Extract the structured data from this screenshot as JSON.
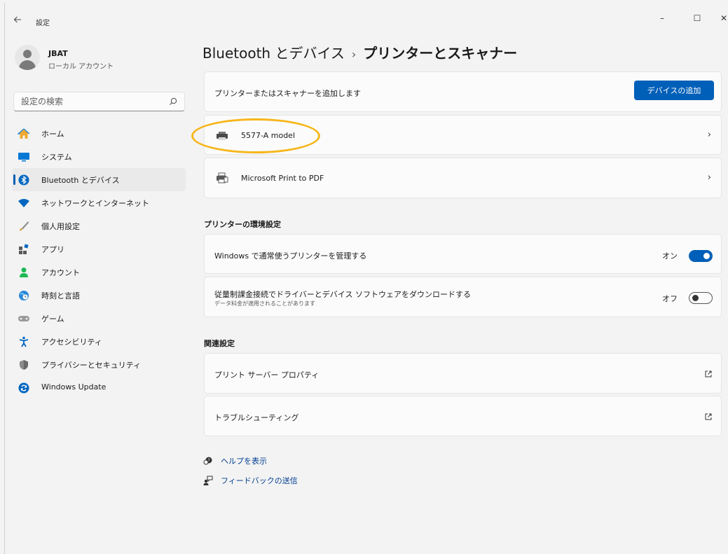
{
  "window": {
    "back_icon": "arrow-left-icon",
    "title": "設定",
    "minimize": "–",
    "maximize": "☐",
    "close": "✕"
  },
  "profile": {
    "name": "JBAT",
    "account_type": "ローカル アカウント"
  },
  "search": {
    "placeholder": "設定の検索"
  },
  "sidebar": {
    "items": [
      {
        "label": "ホーム",
        "icon": "home-icon"
      },
      {
        "label": "システム",
        "icon": "system-icon"
      },
      {
        "label": "Bluetooth とデバイス",
        "icon": "bluetooth-icon",
        "active": true
      },
      {
        "label": "ネットワークとインターネット",
        "icon": "wifi-icon"
      },
      {
        "label": "個人用設定",
        "icon": "brush-icon"
      },
      {
        "label": "アプリ",
        "icon": "apps-icon"
      },
      {
        "label": "アカウント",
        "icon": "person-icon"
      },
      {
        "label": "時刻と言語",
        "icon": "globe-clock-icon"
      },
      {
        "label": "ゲーム",
        "icon": "controller-icon"
      },
      {
        "label": "アクセシビリティ",
        "icon": "accessibility-icon"
      },
      {
        "label": "プライバシーとセキュリティ",
        "icon": "shield-icon"
      },
      {
        "label": "Windows Update",
        "icon": "update-icon"
      }
    ]
  },
  "breadcrumb": {
    "parent": "Bluetooth とデバイス",
    "separator": "›",
    "current": "プリンターとスキャナー"
  },
  "add_card": {
    "label": "プリンターまたはスキャナーを追加します",
    "button": "デバイスの追加"
  },
  "devices": [
    {
      "name": "5577-A model",
      "chevron": "›"
    },
    {
      "name": "Microsoft Print to PDF",
      "chevron": "›"
    }
  ],
  "printer_settings": {
    "title": "プリンターの環境設定",
    "default_printer": {
      "label": "Windows で通常使うプリンターを管理する",
      "state_label": "オン",
      "on": true
    },
    "metered": {
      "label": "従量制課金接続でドライバーとデバイス ソフトウェアをダウンロードする",
      "sublabel": "データ料金が適用されることがあります",
      "state_label": "オフ",
      "on": false
    }
  },
  "related": {
    "title": "関連設定",
    "items": [
      {
        "label": "プリント サーバー プロパティ",
        "icon": "external-link-icon"
      },
      {
        "label": "トラブルシューティング",
        "icon": "external-link-icon"
      }
    ]
  },
  "help_links": [
    {
      "label": "ヘルプを表示",
      "icon": "help-icon"
    },
    {
      "label": "フィードバックの送信",
      "icon": "feedback-icon"
    }
  ],
  "colors": {
    "accent": "#005fb8",
    "highlight_annotation": "#f6b61b"
  }
}
